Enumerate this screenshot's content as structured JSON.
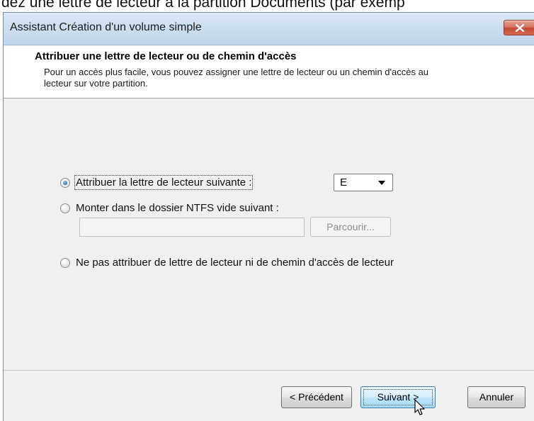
{
  "page_text": "dez une lettre de lecteur à la partition Documents (par exemp",
  "window": {
    "title": "Assistant Création d'un volume simple",
    "close_icon": "close-icon"
  },
  "header": {
    "title": "Attribuer une lettre de lecteur ou de chemin d'accès",
    "description": "Pour un accès plus facile, vous pouvez assigner une lettre de lecteur ou un chemin d'accès au lecteur sur votre partition."
  },
  "options": {
    "assign_letter": {
      "label": "Attribuer la lettre de lecteur suivante :",
      "checked": true
    },
    "mount_folder": {
      "label": "Monter dans le dossier NTFS vide suivant :",
      "checked": false
    },
    "no_letter": {
      "label": "Ne pas attribuer de lettre de lecteur ni de chemin d'accès de lecteur",
      "checked": false
    }
  },
  "drive_select": {
    "value": "E"
  },
  "folder_input": {
    "value": ""
  },
  "browse_button": {
    "label": "Parcourir..."
  },
  "buttons": {
    "previous": "< Précédent",
    "next": "Suivant >",
    "cancel": "Annuler"
  },
  "colors": {
    "titlebar": "#cddfef",
    "close": "#c24a35",
    "accent": "#3c7fb1"
  }
}
